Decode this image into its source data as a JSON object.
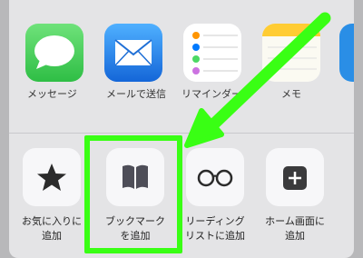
{
  "share_apps": [
    {
      "label": "メッセージ",
      "icon": "messages-icon",
      "color": "#4cd964"
    },
    {
      "label": "メールで送信",
      "icon": "mail-icon",
      "color": "#1e8cf0"
    },
    {
      "label": "リマインダー",
      "icon": "reminders-icon",
      "color": "#ffffff"
    },
    {
      "label": "メモ",
      "icon": "notes-icon",
      "color": "#ffcc33"
    }
  ],
  "actions": [
    {
      "label_line1": "お気に入りに",
      "label_line2": "追加",
      "icon": "star-icon"
    },
    {
      "label_line1": "ブックマーク",
      "label_line2": "を追加",
      "icon": "book-icon"
    },
    {
      "label_line1": "リーディング",
      "label_line2": "リストに追加",
      "icon": "glasses-icon"
    },
    {
      "label_line1": "ホーム画面に",
      "label_line2": "追加",
      "icon": "plus-square-icon"
    }
  ],
  "annotation_color": "#39ff14"
}
